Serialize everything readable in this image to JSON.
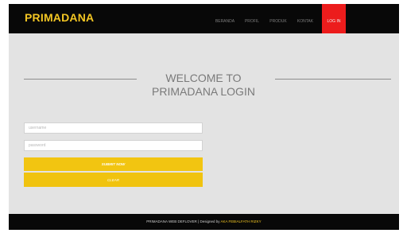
{
  "brand": {
    "name": "PRIMADANA"
  },
  "nav": {
    "items": [
      {
        "label": "BERANDA"
      },
      {
        "label": "PROFIL"
      },
      {
        "label": "PRODUK"
      },
      {
        "label": "KONTAK"
      },
      {
        "label": "LOG IN",
        "active": true
      }
    ]
  },
  "login": {
    "heading_line1": "WELCOME TO",
    "heading_line2": "PRIMADANA LOGIN",
    "username_placeholder": "username",
    "password_placeholder": "password",
    "submit_label": "SUBMIT NOW",
    "clear_label": "CLEAR"
  },
  "footer": {
    "text": "PRIMADANA WEB DEFLOVER | Designed by ",
    "credit": "AKA FEBIALFATH RIZKY"
  },
  "colors": {
    "accent": "#f3c623",
    "active_nav": "#ec1c1c",
    "navbar_bg": "#080808",
    "page_bg": "#e3e3e3"
  }
}
